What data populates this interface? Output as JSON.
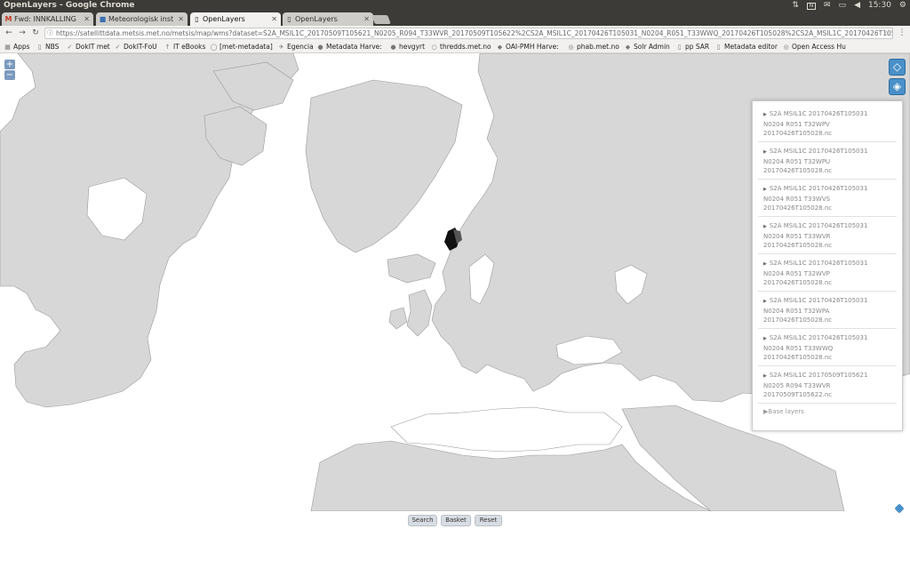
{
  "os": {
    "title": "OpenLayers - Google Chrome",
    "clock": "15:30"
  },
  "tabs": [
    {
      "label": "Fwd: INNKALLING",
      "favicon": "M"
    },
    {
      "label": "Meteorologisk inst",
      "favicon": "■"
    },
    {
      "label": "OpenLayers",
      "favicon": "▯"
    },
    {
      "label": "OpenLayers",
      "favicon": "▯"
    }
  ],
  "toolbar": {
    "url": "https://satellittdata.metsis.met.no/metsis/map/wms?dataset=S2A_MSIL1C_20170509T105621_N0205_R094_T33WVR_20170509T105622%2CS2A_MSIL1C_20170426T105031_N0204_R051_T33WWQ_20170426T105028%2CS2A_MSIL1C_20170426T105031_N0204_R051_T"
  },
  "bookmarks": [
    {
      "label": "Apps",
      "icon": "▦"
    },
    {
      "label": "NBS",
      "icon": "▯"
    },
    {
      "label": "DokIT met",
      "icon": "✓"
    },
    {
      "label": "DokIT-FoU",
      "icon": "✓"
    },
    {
      "label": "IT eBooks",
      "icon": "↑"
    },
    {
      "label": "[met-metadata]",
      "icon": "◯"
    },
    {
      "label": "Egencia",
      "icon": "✈"
    },
    {
      "label": "Metadata Harve:",
      "icon": "●"
    },
    {
      "label": "hevgyrt",
      "icon": "●"
    },
    {
      "label": "thredds.met.no",
      "icon": "○"
    },
    {
      "label": "OAI-PMH Harve:",
      "icon": "◆"
    },
    {
      "label": "phab.met.no",
      "icon": "◎"
    },
    {
      "label": "Solr Admin",
      "icon": "◆"
    },
    {
      "label": "pp SAR",
      "icon": "▯"
    },
    {
      "label": "Metadata editor",
      "icon": "▯"
    },
    {
      "label": "Open Access Hu",
      "icon": "◎"
    }
  ],
  "map": {
    "zoom_in": "+",
    "zoom_out": "−"
  },
  "layers": [
    [
      "S2A MSIL1C 20170426T105031",
      "N0204 R051 T32WPV",
      "20170426T105028.nc"
    ],
    [
      "S2A MSIL1C 20170426T105031",
      "N0204 R051 T32WPU",
      "20170426T105028.nc"
    ],
    [
      "S2A MSIL1C 20170426T105031",
      "N0204 R051 T33WVS",
      "20170426T105028.nc"
    ],
    [
      "S2A MSIL1C 20170426T105031",
      "N0204 R051 T33WVR",
      "20170426T105028.nc"
    ],
    [
      "S2A MSIL1C 20170426T105031",
      "N0204 R051 T32WVP",
      "20170426T105028.nc"
    ],
    [
      "S2A MSIL1C 20170426T105031",
      "N0204 R051 T32WPA",
      "20170426T105028.nc"
    ],
    [
      "S2A MSIL1C 20170426T105031",
      "N0204 R051 T33WWQ",
      "20170426T105028.nc"
    ],
    [
      "S2A MSIL1C 20170509T105621",
      "N0205 R094 T33WVR",
      "20170509T105622.nc"
    ]
  ],
  "base_layers": "Base layers",
  "buttons": {
    "search": "Search",
    "basket": "Basket",
    "reset": "Reset"
  }
}
